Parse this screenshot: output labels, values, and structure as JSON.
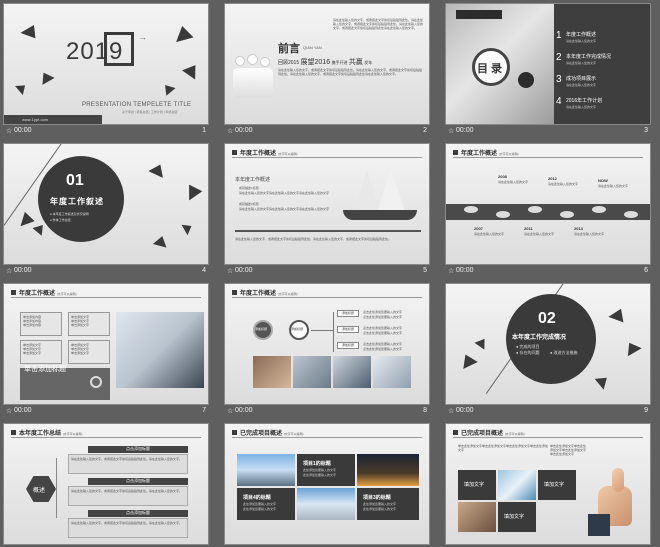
{
  "footer": {
    "time": "00:00"
  },
  "slides": [
    {
      "num": "1",
      "year": "2019",
      "title": "PRESENTATION TEMPELETE TITLE",
      "sub": "关于年终   |   项目总结   |   工作计划   |   年终总结",
      "url": "www.1ppt.com"
    },
    {
      "num": "2",
      "heading": "前言",
      "heading_en": "QIAN YAN",
      "line1_a": "回顾2015",
      "line1_b": "展望2016",
      "line1_c": "携手开进",
      "line1_d": "共赢",
      "line1_e": "发年",
      "body": "请在此处输入您的文字，或者把此文字剪切后粘贴到此处。请在此处输入您的文字，或者把此文字剪切后粘贴到此处。请在此处输入您的文字，或者把此文字剪切后粘贴到此处请在此处输入您的文字。"
    },
    {
      "num": "3",
      "toc_title": "目 录",
      "toc_small": "CONTENTS",
      "items": [
        {
          "n": "1",
          "title": "年度工作概述",
          "desc": "请在此处输入您的文字"
        },
        {
          "n": "2",
          "title": "本年度工作完成情况",
          "desc": "请在此处输入您的文字"
        },
        {
          "n": "3",
          "title": "成功项目展示",
          "desc": "请在此处输入您的文字"
        },
        {
          "n": "4",
          "title": "2016年工作计划",
          "desc": "请在此处输入您的文字"
        }
      ]
    },
    {
      "num": "4",
      "sec": "01",
      "title": "年度工作叙述",
      "b1": "本年度工作叙述及状况说明",
      "b2": "整体工作总结"
    },
    {
      "num": "5",
      "header": "年度工作概述",
      "header_small": "(文字可以编辑)",
      "sub": "本年度工作概述",
      "p1": "成就描述1标题",
      "p2": "成就描述2标题",
      "detail": "请在此处输入您的文字请在此处输入您的文字请在此处输入您的文字",
      "body": "请在此处输入您的文字，或者把此文字剪切后粘贴到此处。请在此处输入您的文字，或者把此文字剪切后粘贴到此处。"
    },
    {
      "num": "6",
      "header": "年度工作概述",
      "header_small": "(文字可以编辑)",
      "years_top": [
        "2008",
        "2012",
        "NOW"
      ],
      "years_bottom": [
        "2007",
        "2011",
        "2014"
      ],
      "desc": "请在此处输入您的文字"
    },
    {
      "num": "7",
      "header": "年度工作概述",
      "header_small": "(文字可以编辑)",
      "boxes": [
        "单击添加内容\n单击添加内容\n单击添加内容",
        "单击添加文字\n单击添加文字\n单击添加文字",
        "单击添加文字\n单击添加文字\n单击添加文字",
        "单击添加文字\n单击添加文字\n单击添加文字"
      ],
      "bottom": "单击添加标题"
    },
    {
      "num": "8",
      "header": "年度工作概述",
      "header_small": "(文字可以编辑)",
      "c1": "添加标题",
      "c2": "添加标题",
      "tags": [
        "添加标题",
        "添加标题",
        "添加标题"
      ],
      "line": "点击此处添加您要输入的文字"
    },
    {
      "num": "9",
      "sec": "02",
      "title": "本年度工作完成情况",
      "bullets": [
        "完成的项目",
        "存在的问题",
        "改进方法措施"
      ]
    },
    {
      "num": "",
      "header": "本年度工作总结",
      "header_small": "(文字可以编辑)",
      "center": "概述",
      "items": [
        "点击添加标题",
        "点击添加标题",
        "点击添加标题"
      ],
      "desc": "请在此处输入您的文字，或者把此文字剪切后粘贴到此处。请在此处输入您的文字。"
    },
    {
      "num": "",
      "header": "已完成项目概述",
      "header_small": "(文字可以编辑)",
      "t1": "项目1的标题",
      "t2": "项目4的标题",
      "t3": "项目3的标题",
      "d": "此处添加您要输入的文字"
    },
    {
      "num": "",
      "header": "已完成项目概述",
      "header_small": "(文字可以编辑)",
      "desc": "单击此处添加文字单击此处添加文字单击此处添加文字单击此处添加文字",
      "f1": "填加文字",
      "f2": "填加文字",
      "f3": "填加文字"
    }
  ]
}
